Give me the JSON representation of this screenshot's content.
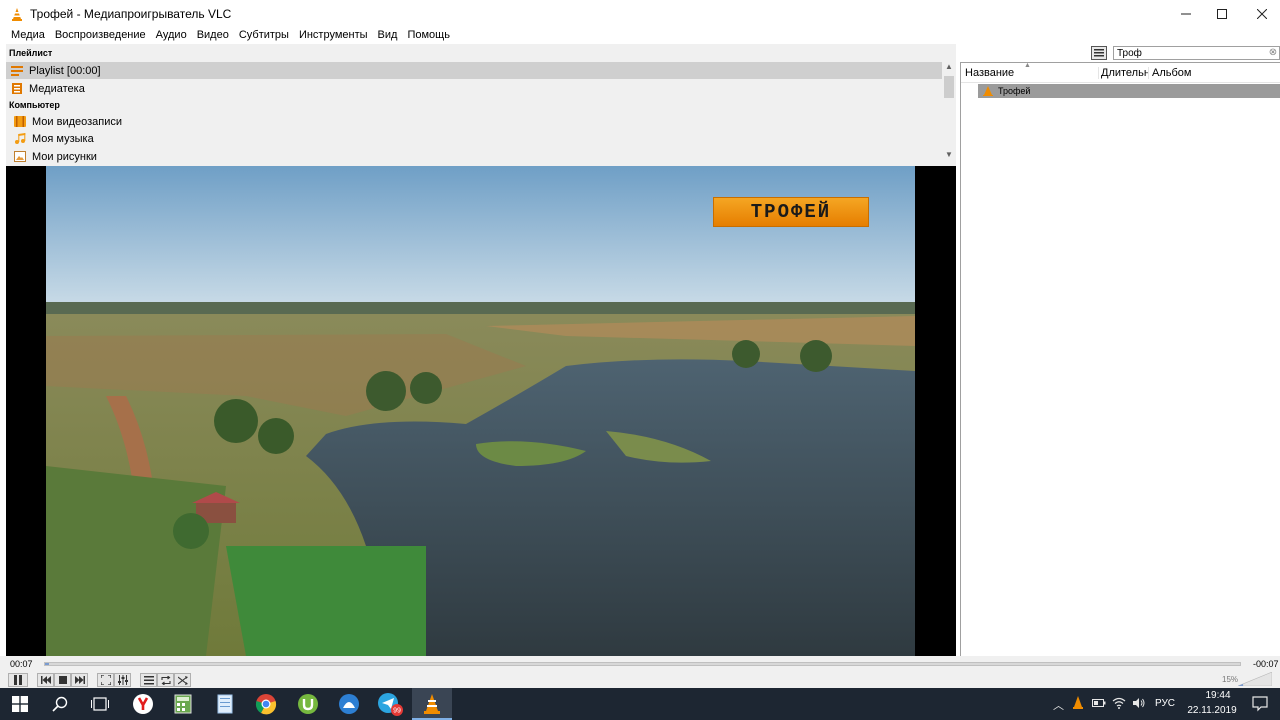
{
  "window": {
    "title": "Трофей - Медиапроигрыватель VLC",
    "minimize": "—",
    "maximize": "☐",
    "close": "✕"
  },
  "menu": [
    "Медиа",
    "Воспроизведение",
    "Аудио",
    "Видео",
    "Субтитры",
    "Инструменты",
    "Вид",
    "Помощь"
  ],
  "sidebar": {
    "playlist_header": "Плейлист",
    "playlist_item": "Playlist [00:00]",
    "library_item": "Медиатека",
    "computer_header": "Компьютер",
    "videos_item": "Мои видеозаписи",
    "music_item": "Моя музыка",
    "pictures_item": "Мои рисунки"
  },
  "search": {
    "value": "Троф"
  },
  "playlist_table": {
    "columns": [
      "Название",
      "Длительность",
      "Альбом"
    ],
    "rows": [
      {
        "title": "Трофей"
      }
    ]
  },
  "video": {
    "channel_logo": "ТРОФЕЙ"
  },
  "playback": {
    "elapsed": "00:07",
    "remaining": "-00:07",
    "progress_fraction": 0.003,
    "volume": "15%"
  },
  "taskbar": {
    "language": "РУС",
    "time": "19:44",
    "date": "22.11.2019",
    "telegram_badge": "99"
  },
  "colors": {
    "vlc_orange": "#f08c00",
    "taskbar_bg": "#1d2632",
    "selected_row": "#cfcfcf"
  },
  "icons": [
    "vlc-cone-icon",
    "playlist-icon",
    "library-icon",
    "videos-folder-icon",
    "music-note-icon",
    "pictures-icon",
    "windows-start-icon",
    "search-icon",
    "task-view-icon",
    "yandex-browser-icon",
    "chrome-icon",
    "torrent-icon",
    "telegram-icon",
    "explorer-icon",
    "notepad-icon",
    "calculator-icon"
  ]
}
